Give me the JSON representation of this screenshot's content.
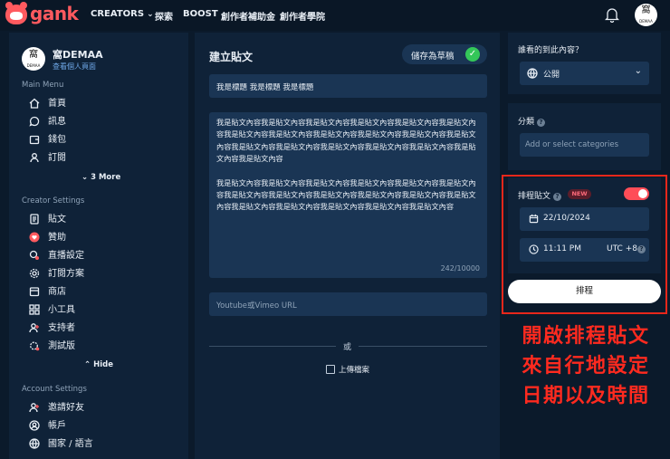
{
  "brand": {
    "logo_text": "gank",
    "avatar_text": "窩",
    "avatar_small": "DEMAA"
  },
  "nav": {
    "creators": "CREATORS",
    "explore": "探索",
    "boost": "BOOST",
    "grant": "創作者補助金",
    "academy": "創作者學院"
  },
  "sidebar": {
    "profile_name": "窩DEMAA",
    "profile_link": "查看個人頁面",
    "main_menu_title": "Main Menu",
    "main_items": [
      {
        "label": "首頁",
        "icon": "home-icon"
      },
      {
        "label": "訊息",
        "icon": "chat-icon"
      },
      {
        "label": "錢包",
        "icon": "wallet-icon"
      },
      {
        "label": "訂閱",
        "icon": "user-icon"
      }
    ],
    "more_label": "3 More",
    "creator_settings_title": "Creator Settings",
    "creator_items": [
      {
        "label": "貼文",
        "icon": "document-icon"
      },
      {
        "label": "贊助",
        "icon": "heart-icon"
      },
      {
        "label": "直播設定",
        "icon": "live-icon"
      },
      {
        "label": "訂閱方案",
        "icon": "settings-icon"
      },
      {
        "label": "商店",
        "icon": "store-icon"
      },
      {
        "label": "小工具",
        "icon": "widgets-icon"
      },
      {
        "label": "支持者",
        "icon": "supporter-icon"
      },
      {
        "label": "測試版",
        "icon": "beta-icon"
      }
    ],
    "hide_label": "Hide",
    "account_settings_title": "Account Settings",
    "account_items": [
      {
        "label": "邀請好友",
        "icon": "invite-icon"
      },
      {
        "label": "帳戶",
        "icon": "account-icon"
      },
      {
        "label": "國家 / 語言",
        "icon": "globe-icon"
      }
    ]
  },
  "editor": {
    "title": "建立貼文",
    "save_draft": "儲存為草稿",
    "title_value": "我是標題 我是標題 我是標題",
    "body_para1": "我是貼文內容我是貼文內容我是貼文內容我是貼文內容我是貼文內容我是貼文內容我是貼文內容我是貼文內容我是貼文內容我是貼文內容我是貼文內容我是貼文內容我是貼文內容我是貼文內容我是貼文內容我是貼文內容我是貼文內容我是貼文內容我是貼文內容",
    "body_para2": "我是貼文內容我是貼文內容我是貼文內容我是貼文內容我是貼文內容我是貼文內容我是貼文內容我是貼文內容我是貼文內容我是貼文內容我是貼文內容我是貼文內容我是貼文內容我是貼文內容我是貼文內容我是貼文內容我是貼文內容",
    "counter": "242/10000",
    "youtube_placeholder": "Youtube或Vimeo URL",
    "or_text": "或",
    "upload_label": "上傳檔案"
  },
  "settings": {
    "visibility_label": "誰看的到此內容？",
    "visibility_value": "公開",
    "category_label": "分類",
    "category_placeholder": "Add or select categories",
    "schedule_label": "排程貼文",
    "new_badge": "NEW",
    "schedule_enabled": true,
    "date": "22/10/2024",
    "time": "11:11 PM",
    "timezone": "UTC +8",
    "schedule_button": "排程"
  },
  "annotation": {
    "line1": "開啟排程貼文",
    "line2": "來自行地設定",
    "line3": "日期以及時間"
  },
  "colors": {
    "accent": "#ff5a5f",
    "annotation": "#ff2a1f",
    "toggle": "#ff4d57",
    "check": "#34c759"
  }
}
